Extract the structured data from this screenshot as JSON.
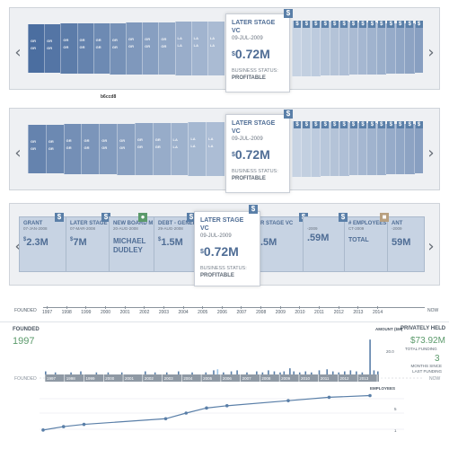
{
  "colors": {
    "accent": "#5a7fa8",
    "dark_bar": "#4b6ea0",
    "light_bar": "#c7d3e3",
    "green": "#5b9a6b",
    "highlight_bar": "#9cc4e6",
    "badge_tan": "#b8a080"
  },
  "carousel1": {
    "slats": [
      "GR",
      "GR",
      "GR",
      "GR",
      "GR",
      "GR",
      "GR",
      "GR",
      "GR",
      "LA",
      "LA",
      "LA"
    ],
    "caption": "b6ccd8",
    "card": {
      "type": "LATER STAGE VC",
      "date": "09-JUL-2009",
      "currency": "$",
      "amount": "0.72M",
      "status_label": "BUSINESS STATUS:",
      "status_value": "PROFITABLE"
    }
  },
  "carousel2": {
    "slats": [
      "GR",
      "GR",
      "GR",
      "GR",
      "GR",
      "GR",
      "GR",
      "GR",
      "LA",
      "LA",
      "LA"
    ],
    "card": {
      "type": "LATER STAGE VC",
      "date": "09-JUL-2009",
      "currency": "$",
      "amount": "0.72M",
      "status_label": "BUSINESS STATUS:",
      "status_value": "PROFITABLE"
    }
  },
  "carousel3": {
    "cards": [
      {
        "type": "GRANT",
        "date": "07-JAN-2008",
        "amount": "2.3M",
        "currency": "$",
        "badge": "$"
      },
      {
        "type": "LATER STAGE VC",
        "date": "07-MAR-2008",
        "amount": "7M",
        "currency": "$",
        "badge": "$"
      },
      {
        "type": "NEW BOARD M",
        "date": "20-AUG-2008",
        "amount": "MICHAEL DUDLEY",
        "currency": "",
        "badge": "person"
      },
      {
        "type": "DEBT - GENERA",
        "date": "29-AUG-2008",
        "amount": "1.5M",
        "currency": "$",
        "badge": "$"
      }
    ],
    "right_cards": [
      {
        "type": "R STAGE VC",
        "date": "",
        "amount": ".5M",
        "currency": "",
        "badge": "$"
      },
      {
        "type": "",
        "date": "-2009",
        "amount": ".59M",
        "currency": "",
        "badge": "$"
      },
      {
        "type": "# EMPLOYEES",
        "date": "CT-2009",
        "amount": "TOTAL",
        "currency": "",
        "badge": "$"
      },
      {
        "type": "ANT",
        "date": "-2009",
        "amount": "59M",
        "currency": "",
        "badge": "tan"
      }
    ],
    "card": {
      "type": "LATER STAGE VC",
      "date": "09-JUL-2009",
      "currency": "$",
      "amount": "0.72M",
      "status_label": "BUSINESS STATUS:",
      "status_value": "PROFITABLE"
    }
  },
  "timeline": {
    "left_label": "FOUNDED",
    "right_label": "NOW",
    "years": [
      "1997",
      "1998",
      "1999",
      "2000",
      "2001",
      "2002",
      "2003",
      "2004",
      "2005",
      "2006",
      "2007",
      "2008",
      "2009",
      "2010",
      "2011",
      "2012",
      "2013",
      "2014"
    ]
  },
  "stats": {
    "founded_label": "FOUNDED",
    "founded_year": "1997",
    "amount_label": "AMOUNT ($M)",
    "privately_held": "PRIVATELY HELD",
    "total_funding": "$73.92M",
    "total_funding_label": "TOTAL FUNDING",
    "months_value": "3",
    "months_label": "MONTHS SINCE LAST FUNDING",
    "scale_20": "20.0",
    "employees_label": "EMPLOYEES",
    "emp_5": "5",
    "emp_1": "1"
  },
  "chart_data": {
    "type": "bar",
    "x_labels": [
      "1997",
      "1998",
      "1999",
      "2000",
      "2001",
      "2002",
      "2003",
      "2004",
      "2005",
      "2006",
      "2007",
      "2008",
      "2009",
      "2010",
      "2011",
      "2012",
      "2013",
      "2014"
    ],
    "ylabel": "AMOUNT ($M)",
    "y_tick": "20.0",
    "funding_bars": [
      {
        "x": 1997.0,
        "v": 3
      },
      {
        "x": 1997.5,
        "v": 2
      },
      {
        "x": 1998.3,
        "v": 2
      },
      {
        "x": 1998.8,
        "v": 3
      },
      {
        "x": 1999.6,
        "v": 2
      },
      {
        "x": 2000.2,
        "v": 2
      },
      {
        "x": 2000.9,
        "v": 2
      },
      {
        "x": 2002.1,
        "v": 3
      },
      {
        "x": 2002.6,
        "v": 2
      },
      {
        "x": 2003.2,
        "v": 2
      },
      {
        "x": 2003.8,
        "v": 3
      },
      {
        "x": 2004.5,
        "v": 2
      },
      {
        "x": 2005.2,
        "v": 2
      },
      {
        "x": 2005.6,
        "v": 4
      },
      {
        "x": 2005.8,
        "v": 5
      },
      {
        "x": 2006.1,
        "v": 2
      },
      {
        "x": 2006.5,
        "v": 3
      },
      {
        "x": 2006.8,
        "v": 4
      },
      {
        "x": 2007.3,
        "v": 2
      },
      {
        "x": 2007.8,
        "v": 3
      },
      {
        "x": 2008.1,
        "v": 2
      },
      {
        "x": 2008.4,
        "v": 4
      },
      {
        "x": 2008.7,
        "v": 3
      },
      {
        "x": 2009.0,
        "v": 2
      },
      {
        "x": 2009.2,
        "v": 3
      },
      {
        "x": 2009.5,
        "v": 6
      },
      {
        "x": 2009.7,
        "v": 3
      },
      {
        "x": 2010.0,
        "v": 2
      },
      {
        "x": 2010.3,
        "v": 3
      },
      {
        "x": 2010.6,
        "v": 2
      },
      {
        "x": 2011.0,
        "v": 4
      },
      {
        "x": 2011.4,
        "v": 5
      },
      {
        "x": 2011.7,
        "v": 3
      },
      {
        "x": 2012.0,
        "v": 2
      },
      {
        "x": 2012.3,
        "v": 3
      },
      {
        "x": 2012.6,
        "v": 4
      },
      {
        "x": 2012.9,
        "v": 3
      },
      {
        "x": 2013.2,
        "v": 2
      },
      {
        "x": 2013.6,
        "v": 26
      },
      {
        "x": 2013.8,
        "v": 4
      },
      {
        "x": 2014.0,
        "v": 3
      }
    ],
    "highlight_x": 2005.8,
    "employees": {
      "x": [
        1997,
        1998,
        1999,
        2003,
        2004,
        2005,
        2006,
        2009,
        2011,
        2013
      ],
      "y": [
        1,
        1.6,
        2.0,
        3.0,
        4.0,
        4.9,
        5.3,
        6.2,
        6.8,
        7.1
      ]
    }
  }
}
